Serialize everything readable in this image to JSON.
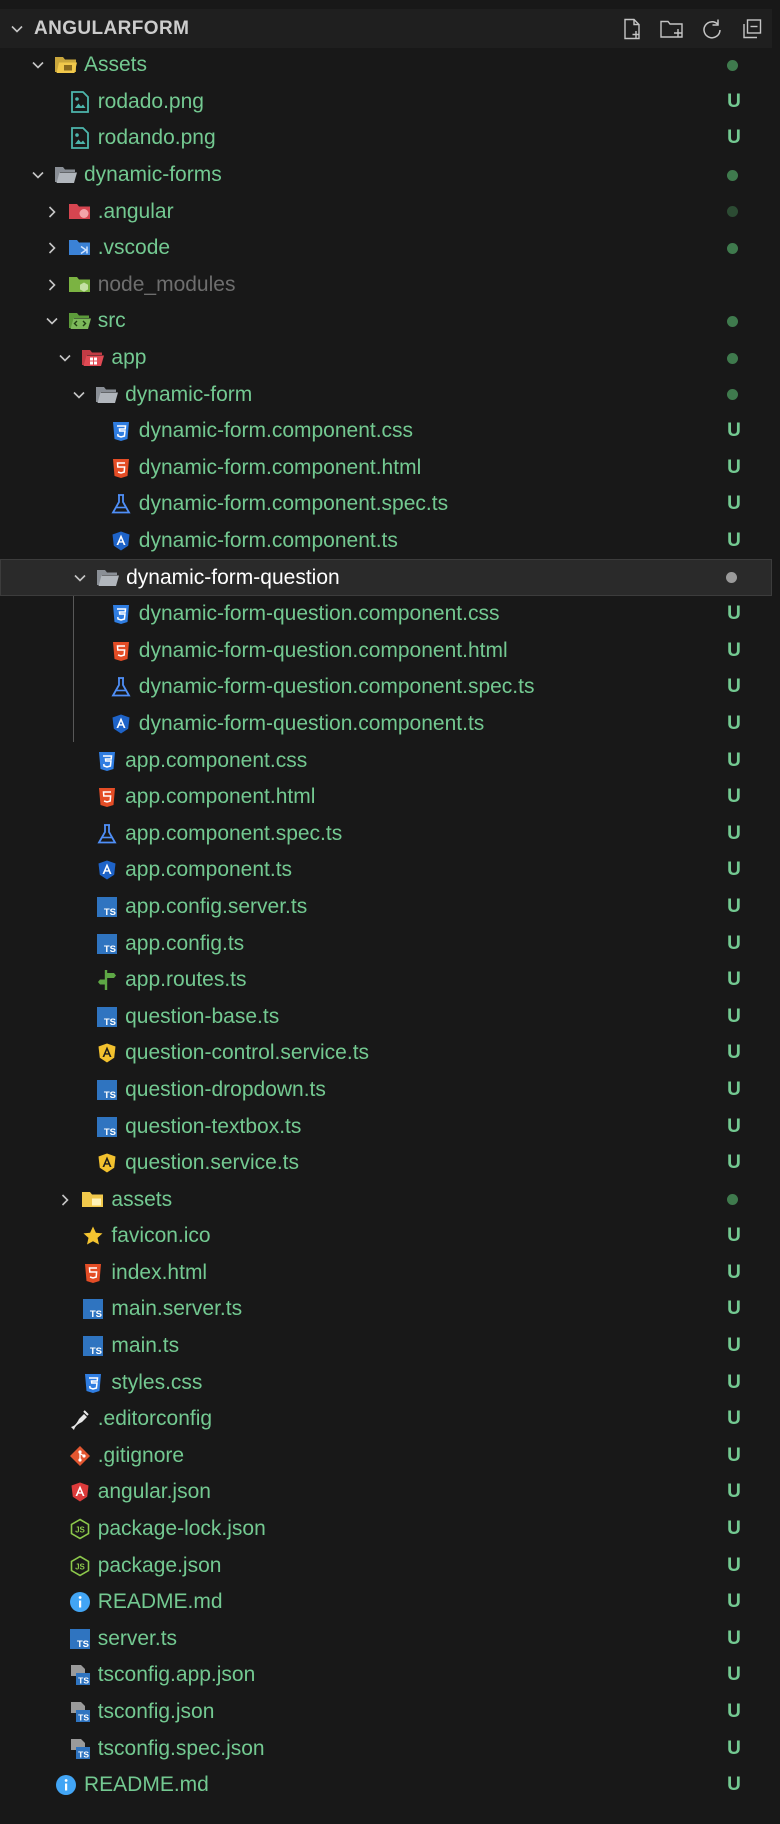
{
  "explorer": {
    "title": "ANGULARFORM",
    "actions": [
      {
        "name": "new-file-icon"
      },
      {
        "name": "new-folder-icon"
      },
      {
        "name": "refresh-icon"
      },
      {
        "name": "collapse-all-icon"
      }
    ]
  },
  "colors": {
    "untracked": "#73c991",
    "dot": "#3f7a4d",
    "background": "#181818",
    "selected": "#2a2a2a"
  },
  "tree": [
    {
      "label": "Assets",
      "depth": 1,
      "type": "folder",
      "open": true,
      "icon": "folder-images-icon",
      "status": "dot"
    },
    {
      "label": "rodado.png",
      "depth": 2,
      "type": "file",
      "icon": "image-file-icon",
      "status": "U"
    },
    {
      "label": "rodando.png",
      "depth": 2,
      "type": "file",
      "icon": "image-file-icon",
      "status": "U"
    },
    {
      "label": "dynamic-forms",
      "depth": 1,
      "type": "folder",
      "open": true,
      "icon": "folder-open-icon",
      "status": "dot"
    },
    {
      "label": ".angular",
      "depth": 2,
      "type": "folder",
      "open": false,
      "icon": "folder-angular-icon",
      "status": "dot-dim"
    },
    {
      "label": ".vscode",
      "depth": 2,
      "type": "folder",
      "open": false,
      "icon": "folder-vscode-icon",
      "status": "dot"
    },
    {
      "label": "node_modules",
      "depth": 2,
      "type": "folder",
      "open": false,
      "icon": "folder-node-icon",
      "status": "",
      "dim": true
    },
    {
      "label": "src",
      "depth": 2,
      "type": "folder",
      "open": true,
      "icon": "folder-src-icon",
      "status": "dot"
    },
    {
      "label": "app",
      "depth": 3,
      "type": "folder",
      "open": true,
      "icon": "folder-app-icon",
      "status": "dot"
    },
    {
      "label": "dynamic-form",
      "depth": 4,
      "type": "folder",
      "open": true,
      "icon": "folder-open-icon",
      "status": "dot"
    },
    {
      "label": "dynamic-form.component.css",
      "depth": 5,
      "type": "file",
      "icon": "css-file-icon",
      "status": "U"
    },
    {
      "label": "dynamic-form.component.html",
      "depth": 5,
      "type": "file",
      "icon": "html-file-icon",
      "status": "U"
    },
    {
      "label": "dynamic-form.component.spec.ts",
      "depth": 5,
      "type": "file",
      "icon": "test-file-icon",
      "status": "U"
    },
    {
      "label": "dynamic-form.component.ts",
      "depth": 5,
      "type": "file",
      "icon": "angular-component-icon",
      "status": "U"
    },
    {
      "label": "dynamic-form-question",
      "depth": 4,
      "type": "folder",
      "open": true,
      "icon": "folder-open-icon",
      "status": "dot-grey",
      "selected": true
    },
    {
      "label": "dynamic-form-question.component.css",
      "depth": 5,
      "type": "file",
      "icon": "css-file-icon",
      "status": "U"
    },
    {
      "label": "dynamic-form-question.component.html",
      "depth": 5,
      "type": "file",
      "icon": "html-file-icon",
      "status": "U"
    },
    {
      "label": "dynamic-form-question.component.spec.ts",
      "depth": 5,
      "type": "file",
      "icon": "test-file-icon",
      "status": "U"
    },
    {
      "label": "dynamic-form-question.component.ts",
      "depth": 5,
      "type": "file",
      "icon": "angular-component-icon",
      "status": "U"
    },
    {
      "label": "app.component.css",
      "depth": 4,
      "type": "file",
      "icon": "css-file-icon",
      "status": "U"
    },
    {
      "label": "app.component.html",
      "depth": 4,
      "type": "file",
      "icon": "html-file-icon",
      "status": "U"
    },
    {
      "label": "app.component.spec.ts",
      "depth": 4,
      "type": "file",
      "icon": "test-file-icon",
      "status": "U"
    },
    {
      "label": "app.component.ts",
      "depth": 4,
      "type": "file",
      "icon": "angular-component-icon",
      "status": "U"
    },
    {
      "label": "app.config.server.ts",
      "depth": 4,
      "type": "file",
      "icon": "ts-file-icon",
      "status": "U"
    },
    {
      "label": "app.config.ts",
      "depth": 4,
      "type": "file",
      "icon": "ts-file-icon",
      "status": "U"
    },
    {
      "label": "app.routes.ts",
      "depth": 4,
      "type": "file",
      "icon": "routes-file-icon",
      "status": "U"
    },
    {
      "label": "question-base.ts",
      "depth": 4,
      "type": "file",
      "icon": "ts-file-icon",
      "status": "U"
    },
    {
      "label": "question-control.service.ts",
      "depth": 4,
      "type": "file",
      "icon": "angular-service-icon",
      "status": "U"
    },
    {
      "label": "question-dropdown.ts",
      "depth": 4,
      "type": "file",
      "icon": "ts-file-icon",
      "status": "U"
    },
    {
      "label": "question-textbox.ts",
      "depth": 4,
      "type": "file",
      "icon": "ts-file-icon",
      "status": "U"
    },
    {
      "label": "question.service.ts",
      "depth": 4,
      "type": "file",
      "icon": "angular-service-icon",
      "status": "U"
    },
    {
      "label": "assets",
      "depth": 3,
      "type": "folder",
      "open": false,
      "icon": "folder-assets-icon",
      "status": "dot"
    },
    {
      "label": "favicon.ico",
      "depth": 3,
      "type": "file",
      "icon": "star-icon",
      "status": "U"
    },
    {
      "label": "index.html",
      "depth": 3,
      "type": "file",
      "icon": "html-file-icon",
      "status": "U"
    },
    {
      "label": "main.server.ts",
      "depth": 3,
      "type": "file",
      "icon": "ts-file-icon",
      "status": "U"
    },
    {
      "label": "main.ts",
      "depth": 3,
      "type": "file",
      "icon": "ts-file-icon",
      "status": "U"
    },
    {
      "label": "styles.css",
      "depth": 3,
      "type": "file",
      "icon": "css-file-icon",
      "status": "U"
    },
    {
      "label": ".editorconfig",
      "depth": 2,
      "type": "file",
      "icon": "editorconfig-icon",
      "status": "U"
    },
    {
      "label": ".gitignore",
      "depth": 2,
      "type": "file",
      "icon": "git-icon",
      "status": "U"
    },
    {
      "label": "angular.json",
      "depth": 2,
      "type": "file",
      "icon": "angular-icon",
      "status": "U"
    },
    {
      "label": "package-lock.json",
      "depth": 2,
      "type": "file",
      "icon": "nodejs-icon",
      "status": "U"
    },
    {
      "label": "package.json",
      "depth": 2,
      "type": "file",
      "icon": "nodejs-icon",
      "status": "U"
    },
    {
      "label": "README.md",
      "depth": 2,
      "type": "file",
      "icon": "info-icon",
      "status": "U"
    },
    {
      "label": "server.ts",
      "depth": 2,
      "type": "file",
      "icon": "ts-file-icon",
      "status": "U"
    },
    {
      "label": "tsconfig.app.json",
      "depth": 2,
      "type": "file",
      "icon": "tsconfig-icon",
      "status": "U"
    },
    {
      "label": "tsconfig.json",
      "depth": 2,
      "type": "file",
      "icon": "tsconfig-icon",
      "status": "U"
    },
    {
      "label": "tsconfig.spec.json",
      "depth": 2,
      "type": "file",
      "icon": "tsconfig-icon",
      "status": "U"
    },
    {
      "label": "README.md",
      "depth": 1,
      "type": "file",
      "icon": "info-icon",
      "status": "U"
    }
  ]
}
